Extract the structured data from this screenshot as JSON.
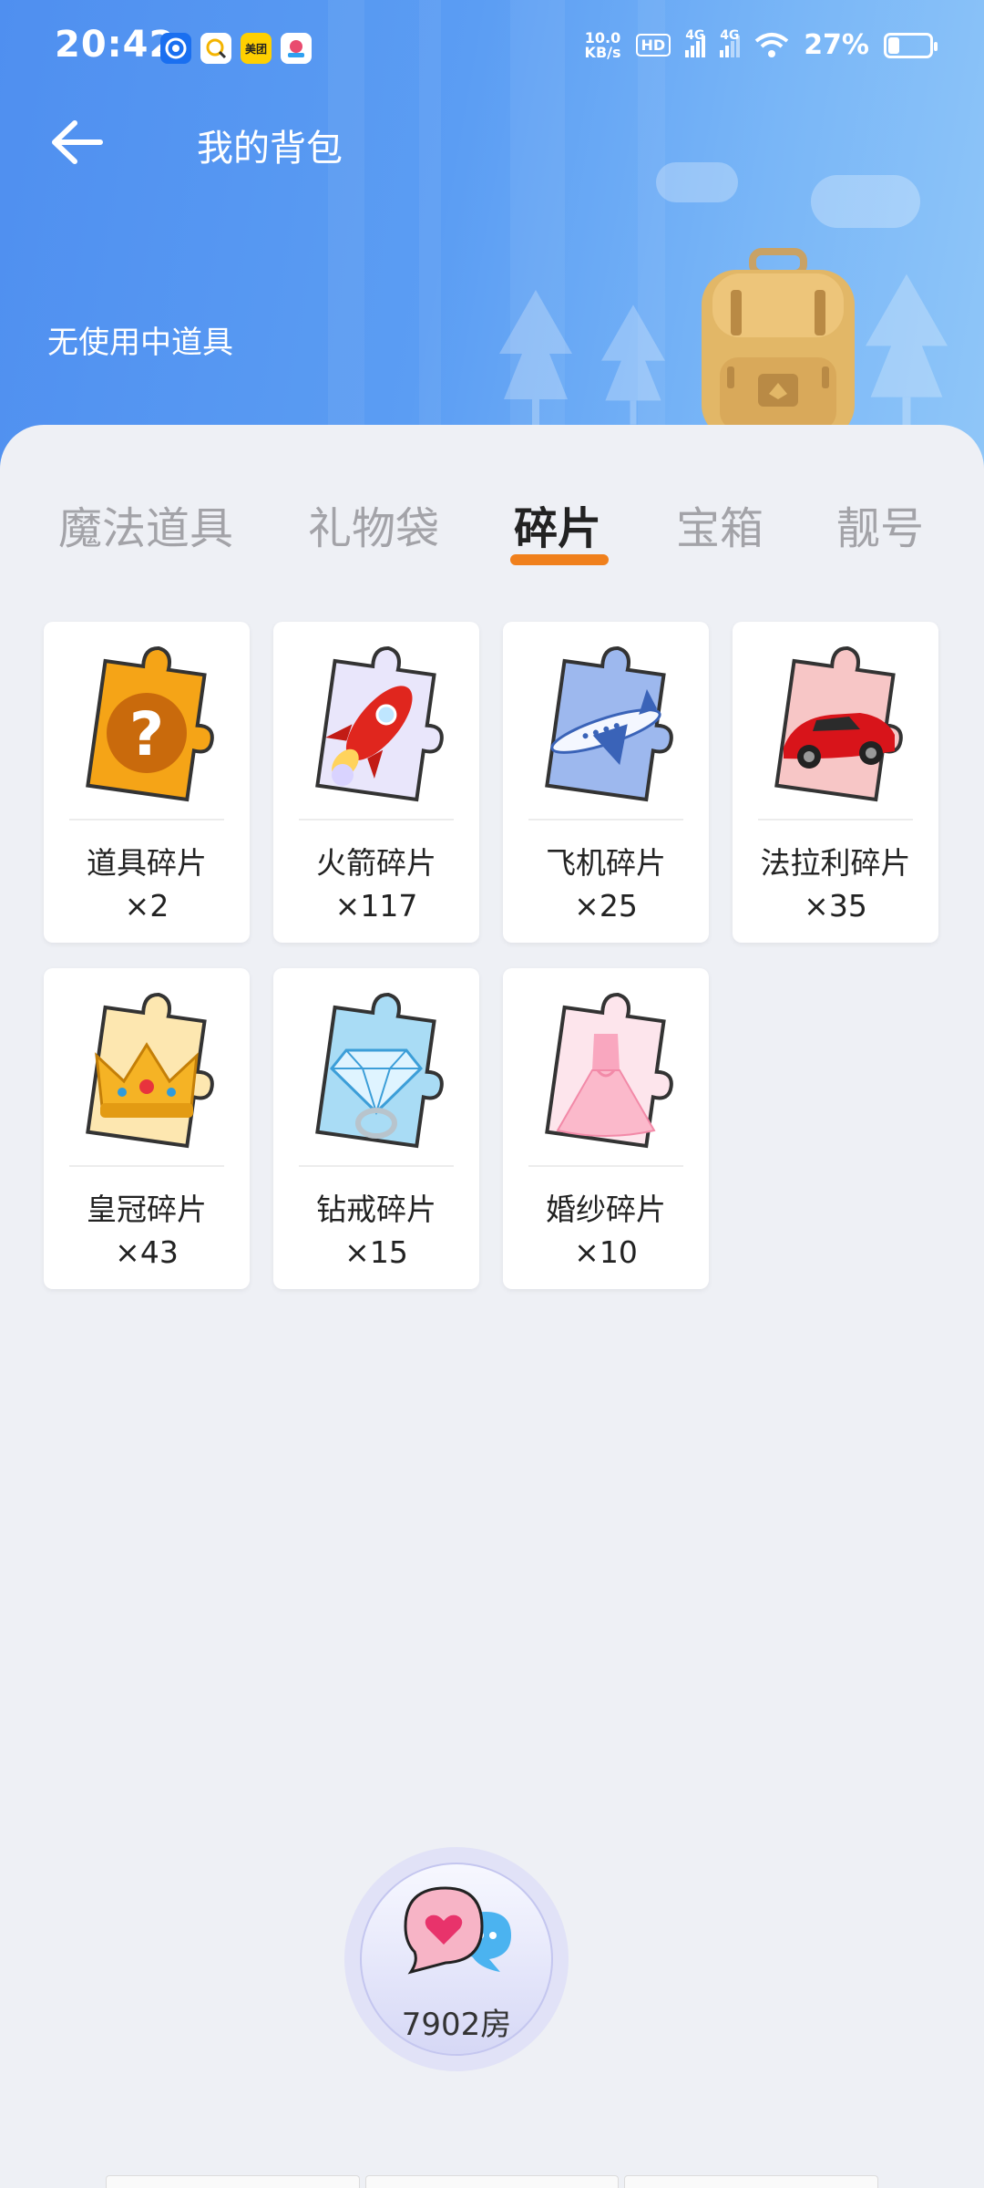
{
  "status_bar": {
    "time": "20:42",
    "net_speed_value": "10.0",
    "net_speed_unit": "KB/s",
    "hd_label": "HD",
    "signal_1": "4G",
    "signal_2": "4G",
    "battery": "27%",
    "battery_level": 0.27,
    "meituan_label": "美团"
  },
  "header": {
    "title": "我的背包",
    "no_item_text": "无使用中道具"
  },
  "tabs": [
    {
      "label": "魔法道具",
      "active": false
    },
    {
      "label": "礼物袋",
      "active": false
    },
    {
      "label": "碎片",
      "active": true
    },
    {
      "label": "宝箱",
      "active": false
    },
    {
      "label": "靓号",
      "active": false
    }
  ],
  "items": [
    {
      "name": "道具碎片",
      "count": "×2",
      "icon": "question-puzzle-icon"
    },
    {
      "name": "火箭碎片",
      "count": "×117",
      "icon": "rocket-puzzle-icon"
    },
    {
      "name": "飞机碎片",
      "count": "×25",
      "icon": "airplane-puzzle-icon"
    },
    {
      "name": "法拉利碎片",
      "count": "×35",
      "icon": "sports-car-puzzle-icon"
    },
    {
      "name": "皇冠碎片",
      "count": "×43",
      "icon": "crown-puzzle-icon"
    },
    {
      "name": "钻戒碎片",
      "count": "×15",
      "icon": "diamond-ring-puzzle-icon"
    },
    {
      "name": "婚纱碎片",
      "count": "×10",
      "icon": "wedding-dress-puzzle-icon"
    }
  ],
  "room_button": {
    "label": "7902房"
  },
  "colors": {
    "header_blue": "#5b9df3",
    "tab_indicator": "#f0801c",
    "page_bg": "#eef0f5"
  }
}
